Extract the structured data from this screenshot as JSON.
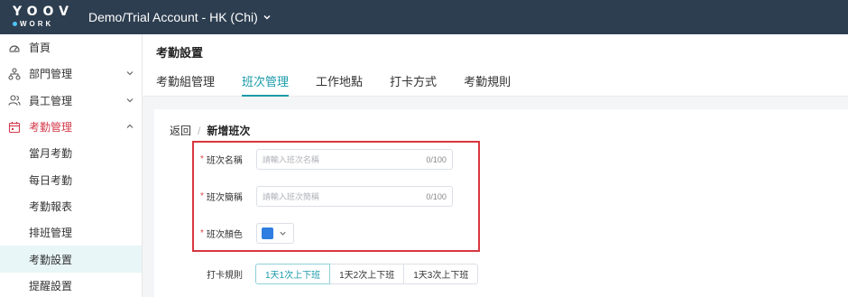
{
  "brand": {
    "logo_top": "YOOV",
    "logo_bottom": "WORK"
  },
  "account": {
    "name": "Demo/Trial Account - HK (Chi)"
  },
  "sidebar": {
    "items": [
      {
        "label": "首頁",
        "icon": "dashboard-icon"
      },
      {
        "label": "部門管理",
        "icon": "org-chart-icon"
      },
      {
        "label": "員工管理",
        "icon": "users-icon"
      },
      {
        "label": "考勤管理",
        "icon": "calendar-icon"
      },
      {
        "label": "當月考勤"
      },
      {
        "label": "每日考勤"
      },
      {
        "label": "考勤報表"
      },
      {
        "label": "排班管理"
      },
      {
        "label": "考勤設置"
      },
      {
        "label": "提醒設置"
      }
    ]
  },
  "page": {
    "title": "考勤設置"
  },
  "tabs": [
    {
      "label": "考勤組管理"
    },
    {
      "label": "班次管理"
    },
    {
      "label": "工作地點"
    },
    {
      "label": "打卡方式"
    },
    {
      "label": "考勤規則"
    }
  ],
  "breadcrumb": {
    "back": "返回",
    "separator": "/",
    "current": "新增班次"
  },
  "form": {
    "required_mark": "*",
    "shift_name": {
      "label": "班次名稱",
      "placeholder": "請輸入班次名稱",
      "count": "0/100"
    },
    "shift_short": {
      "label": "班次簡稱",
      "placeholder": "請輸入班次簡稱",
      "count": "0/100"
    },
    "shift_color": {
      "label": "班次顏色",
      "value": "#2f7de1"
    }
  },
  "punch_rule": {
    "label": "打卡規則",
    "options": [
      {
        "label": "1天1次上下班"
      },
      {
        "label": "1天2次上下班"
      },
      {
        "label": "1天3次上下班"
      }
    ]
  },
  "colors": {
    "accent": "#1b9aaa",
    "topbar": "#2d3e50",
    "active_nav": "#d33a4a",
    "highlight": "#d9363e"
  }
}
